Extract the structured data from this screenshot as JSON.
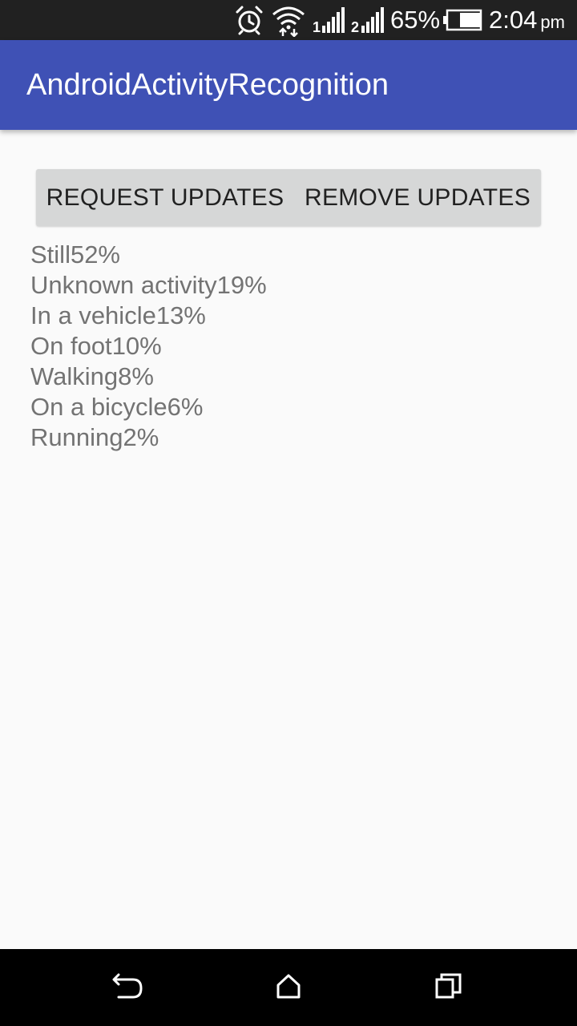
{
  "status_bar": {
    "battery_percent": "65%",
    "time": "2:04",
    "time_suffix": "pm",
    "battery_level": 0.65,
    "icons": [
      "alarm-icon",
      "wifi-icon",
      "signal-1-icon",
      "signal-2-icon",
      "battery-icon"
    ]
  },
  "app_bar": {
    "title": "AndroidActivityRecognition",
    "color": "#3f51b5"
  },
  "buttons": {
    "request_label": "REQUEST UPDATES",
    "remove_label": "REMOVE UPDATES"
  },
  "activities": [
    {
      "name": "Still",
      "confidence": "52%"
    },
    {
      "name": "Unknown activity",
      "confidence": "19%"
    },
    {
      "name": "In a vehicle",
      "confidence": "13%"
    },
    {
      "name": "On foot",
      "confidence": "10%"
    },
    {
      "name": "Walking",
      "confidence": "8%"
    },
    {
      "name": "On a bicycle",
      "confidence": "6%"
    },
    {
      "name": "Running",
      "confidence": "2%"
    }
  ],
  "nav_bar": {
    "icons": [
      "back-icon",
      "home-icon",
      "recents-icon"
    ]
  }
}
